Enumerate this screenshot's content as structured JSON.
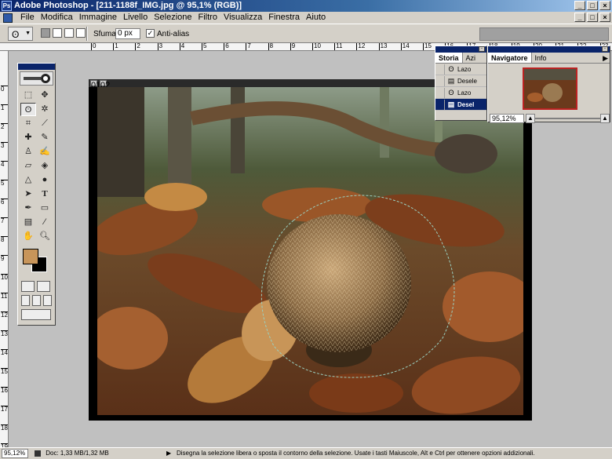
{
  "window": {
    "title": "Adobe Photoshop - [211-1188f_IMG.jpg @ 95,1% (RGB)]",
    "controls": [
      "_",
      "□",
      "×"
    ]
  },
  "menu": [
    "File",
    "Modifica",
    "Immagine",
    "Livello",
    "Selezione",
    "Filtro",
    "Visualizza",
    "Finestra",
    "Aiuto"
  ],
  "options": {
    "feather_label": "Sfuma:",
    "feather_value": "0 px",
    "antialias_label": "Anti-alias",
    "antialias_checked": true
  },
  "rulers": {
    "horizontal": [
      "0",
      "1",
      "2",
      "3",
      "4",
      "5",
      "6",
      "7",
      "8",
      "9",
      "10",
      "11",
      "12",
      "13",
      "14",
      "15",
      "16",
      "17",
      "18",
      "19",
      "20",
      "21",
      "22",
      "23",
      "24",
      "25",
      "26",
      "27"
    ],
    "vertical": [
      "0",
      "1",
      "2",
      "3",
      "4",
      "5",
      "6",
      "7",
      "8",
      "9",
      "10",
      "11",
      "12",
      "13",
      "14",
      "15",
      "16",
      "17",
      "18",
      "19",
      "20"
    ]
  },
  "toolbox": {
    "tools": [
      "marquee",
      "move",
      "lasso",
      "magic-wand",
      "crop",
      "slice",
      "healing",
      "brush",
      "stamp",
      "history-brush",
      "eraser",
      "fill",
      "blur",
      "dodge",
      "path-select",
      "type",
      "pen",
      "shape",
      "notes",
      "eyedropper",
      "hand",
      "zoom"
    ],
    "foreground_color": "#c8955a",
    "background_color": "#000000"
  },
  "document": {
    "header_icons": [
      "01",
      "02"
    ]
  },
  "history_palette": {
    "tabs": [
      "Storia",
      "Azi"
    ],
    "items": [
      {
        "label": "Lazo",
        "selected": false
      },
      {
        "label": "Desele",
        "selected": false
      },
      {
        "label": "Lazo",
        "selected": false
      },
      {
        "label": "Desel",
        "selected": true
      }
    ]
  },
  "navigator_palette": {
    "tabs": [
      "Navigatore",
      "Info"
    ],
    "zoom": "95,12%"
  },
  "status": {
    "zoom": "95,12%",
    "doc": "Doc: 1,33 MB/1,32 MB",
    "hint": "Disegna la selezione libera o sposta il contorno della selezione.  Usate i tasti Maiuscole, Alt e Ctrl per ottenere opzioni addizionali."
  }
}
